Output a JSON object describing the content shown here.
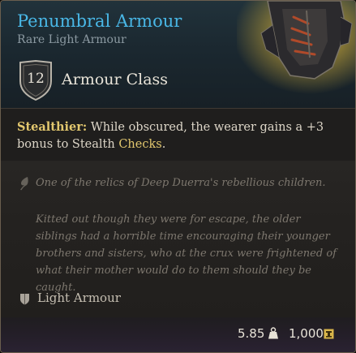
{
  "item": {
    "name": "Penumbral Armour",
    "rarity_type": "Rare Light Armour",
    "armour_class_value": "12",
    "armour_class_label": "Armour Class",
    "effect_name": "Stealthier:",
    "effect_text_1": " While obscured, the wearer gains a +3 bonus to Stealth ",
    "effect_link": "Checks",
    "effect_text_2": ".",
    "flavor_1": "One of the relics of Deep Duerra's rebellious children.",
    "flavor_2": "Kitted out though they were for escape, the older siblings had a horrible time encouraging their younger brothers and sisters, who at the crux were frightened of what their mother would do to them should they be caught.",
    "type": "Light Armour",
    "weight": "5.85",
    "price": "1,000"
  },
  "colors": {
    "title": "#49b7e6",
    "keyword": "#e2c76e",
    "flavor": "#7d776e"
  },
  "icons": {
    "armour_class": "shield-icon",
    "flavor": "quill-icon",
    "type": "light-armour-icon",
    "weight": "weight-icon",
    "price": "gold-coin-icon"
  }
}
